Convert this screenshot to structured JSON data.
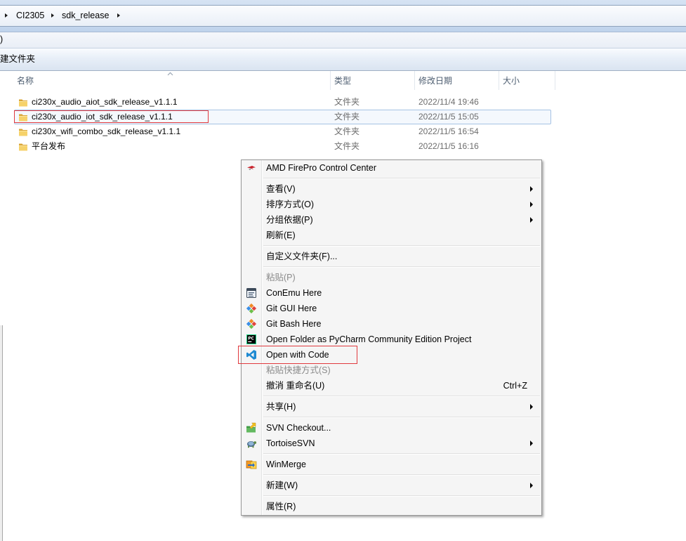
{
  "address_bar": {
    "breadcrumb": [
      "CI2305",
      "sdk_release"
    ],
    "separator_icon": "chevron-right-icon"
  },
  "menubar": {
    "visible_text": ")"
  },
  "toolbar": {
    "new_folder_label": "建文件夹"
  },
  "file_list": {
    "columns": {
      "name": "名称",
      "type": "类型",
      "modified": "修改日期",
      "size": "大小"
    },
    "sort_indicator_icon": "sort-up-icon",
    "rows": [
      {
        "icon": "folder-icon",
        "name": "ci230x_audio_aiot_sdk_release_v1.1.1",
        "type": "文件夹",
        "modified": "2022/11/4 19:46",
        "selected": false
      },
      {
        "icon": "folder-icon",
        "name": "ci230x_audio_iot_sdk_release_v1.1.1",
        "type": "文件夹",
        "modified": "2022/11/5 15:05",
        "selected": true,
        "highlighted": true
      },
      {
        "icon": "folder-icon",
        "name": "ci230x_wifi_combo_sdk_release_v1.1.1",
        "type": "文件夹",
        "modified": "2022/11/5 16:54",
        "selected": false
      },
      {
        "icon": "folder-icon",
        "name": "平台发布",
        "type": "文件夹",
        "modified": "2022/11/5 16:16",
        "selected": false
      }
    ]
  },
  "context_menu": {
    "items": [
      {
        "label": "AMD FirePro Control Center",
        "icon": "amd-icon"
      },
      {
        "label": "查看(V)",
        "submenu": true
      },
      {
        "label": "排序方式(O)",
        "submenu": true
      },
      {
        "label": "分组依据(P)",
        "submenu": true
      },
      {
        "label": "刷新(E)"
      },
      {
        "label": "自定义文件夹(F)..."
      },
      {
        "label": "粘贴(P)",
        "disabled": true
      },
      {
        "label": "ConEmu Here",
        "icon": "conemu-icon"
      },
      {
        "label": "Git GUI Here",
        "icon": "git-gui-icon"
      },
      {
        "label": "Git Bash Here",
        "icon": "git-bash-icon"
      },
      {
        "label": "Open Folder as PyCharm Community Edition Project",
        "icon": "pycharm-icon",
        "icon_text": "PC"
      },
      {
        "label": "Open with Code",
        "icon": "vscode-icon",
        "highlighted": true
      },
      {
        "label": "粘贴快捷方式(S)",
        "disabled": true
      },
      {
        "label": "撤消 重命名(U)",
        "shortcut": "Ctrl+Z"
      },
      {
        "label": "共享(H)",
        "submenu": true
      },
      {
        "label": "SVN Checkout...",
        "icon": "svn-checkout-icon"
      },
      {
        "label": "TortoiseSVN",
        "icon": "tortoisesvn-icon",
        "submenu": true
      },
      {
        "label": "WinMerge",
        "icon": "winmerge-icon"
      },
      {
        "label": "新建(W)",
        "submenu": true
      },
      {
        "label": "属性(R)"
      }
    ]
  },
  "colors": {
    "selection_border": "#a5c2e4",
    "highlight_box": "#e0393e",
    "disabled_text": "#8a8a8a",
    "secondary_text": "#6d6d6d",
    "header_text": "#4d5d70"
  }
}
